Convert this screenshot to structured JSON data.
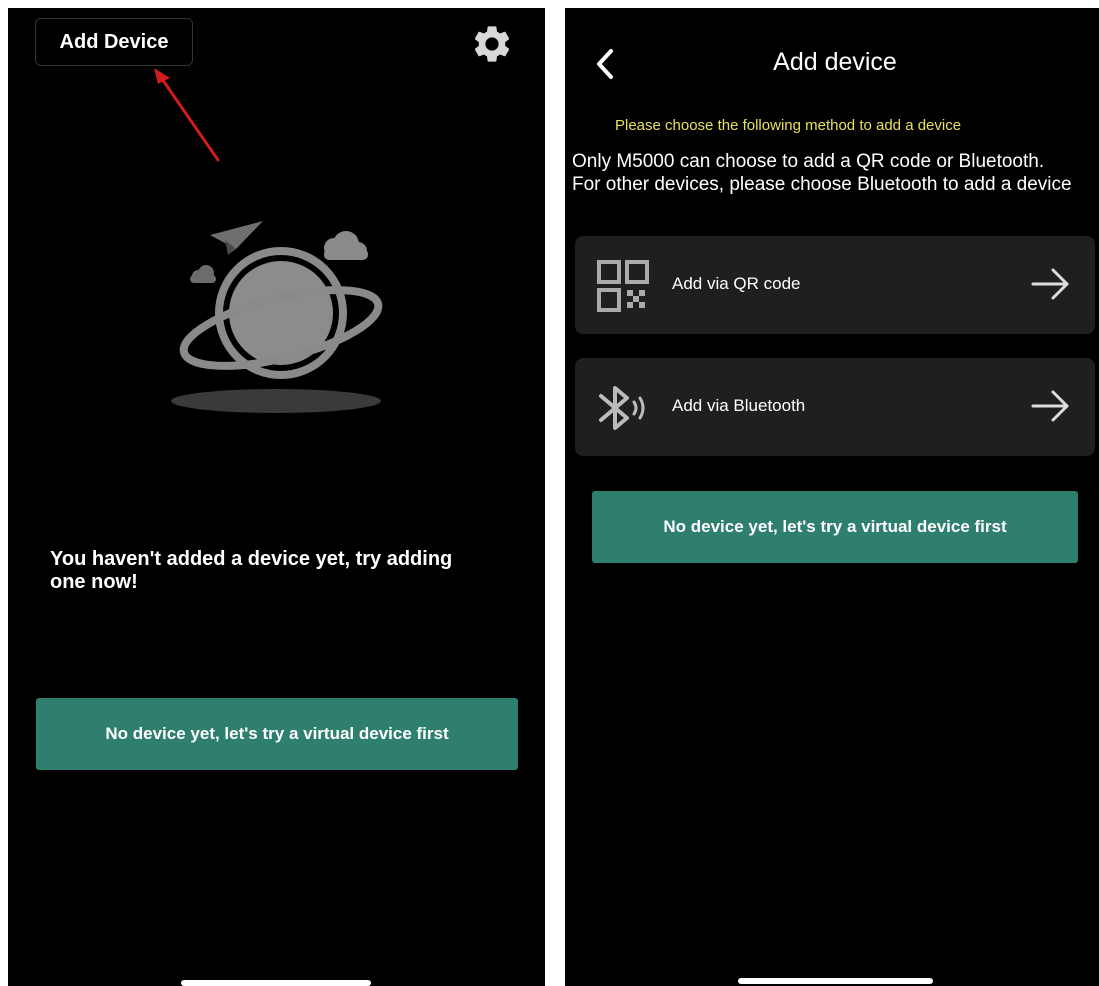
{
  "left": {
    "add_device_label": "Add Device",
    "empty_message": "You haven't added a device yet, try adding one now!",
    "virtual_button_label": "No device yet, let's try a virtual device first"
  },
  "right": {
    "title": "Add device",
    "hint": "Please choose the following method to add a device",
    "description": "Only M5000 can choose to add a QR code or Bluetooth. For other devices, please choose Bluetooth to add a device",
    "methods": [
      {
        "label": "Add via QR code",
        "icon": "qr-code-icon"
      },
      {
        "label": "Add via Bluetooth",
        "icon": "bluetooth-icon"
      }
    ],
    "virtual_button_label": "No device yet, let's try a virtual device first"
  },
  "colors": {
    "accent_button": "#2f7f6f",
    "hint_text": "#e7e05d",
    "card_bg": "#1f1f1f",
    "annotation_arrow": "#d01c1c"
  }
}
